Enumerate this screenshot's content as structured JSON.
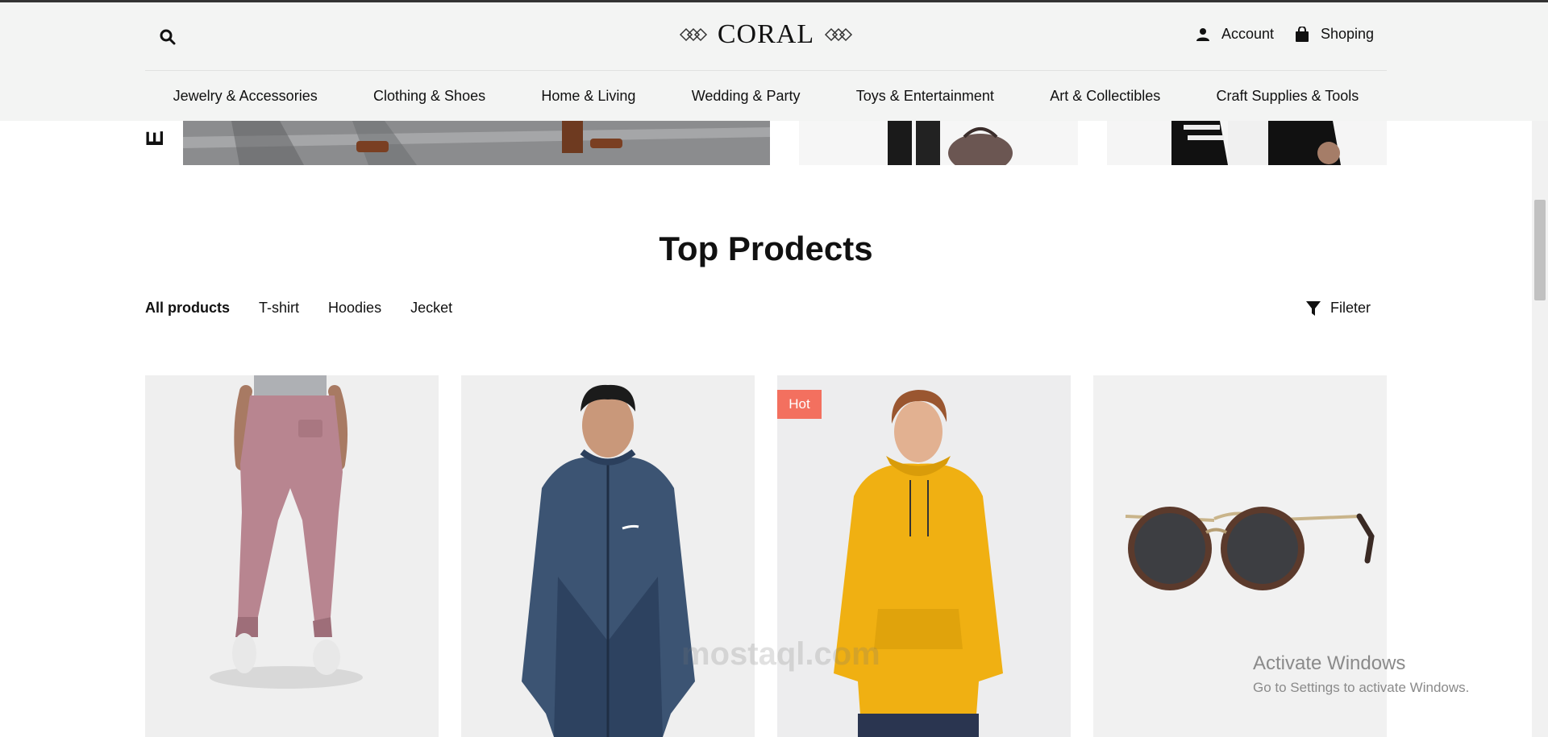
{
  "header": {
    "logo_text": "CORAL",
    "account_label": "Account",
    "shopping_label": "Shoping",
    "icons": {
      "search": "search-icon",
      "account": "user-icon",
      "cart": "shopping-bag-icon"
    }
  },
  "nav": {
    "items": [
      {
        "label": "Jewelry & Accessories"
      },
      {
        "label": "Clothing & Shoes"
      },
      {
        "label": "Home & Living"
      },
      {
        "label": "Wedding & Party"
      },
      {
        "label": "Toys & Entertainment"
      },
      {
        "label": "Art & Collectibles"
      },
      {
        "label": "Craft Supplies & Tools"
      }
    ]
  },
  "banner": {
    "vertical_text": "E"
  },
  "section": {
    "title": "Top Prodects"
  },
  "tabs": {
    "items": [
      {
        "label": "All products"
      },
      {
        "label": "T-shirt"
      },
      {
        "label": "Hoodies"
      },
      {
        "label": "Jecket"
      }
    ],
    "active": "All products"
  },
  "filter": {
    "label": "Fileter",
    "icon": "funnel-icon"
  },
  "products": [
    {
      "image": "pink-jogger-pants"
    },
    {
      "image": "navy-windbreaker-jacket"
    },
    {
      "image": "yellow-hoodie",
      "badge": "Hot"
    },
    {
      "image": "tortoise-sunglasses"
    }
  ],
  "colors": {
    "badge": "#f3705f",
    "header_bg": "#f3f4f3",
    "text": "#111111"
  },
  "watermark": {
    "windows_line1": "Activate Windows",
    "windows_line2": "Go to Settings to activate Windows.",
    "site": "mostaql.com"
  }
}
